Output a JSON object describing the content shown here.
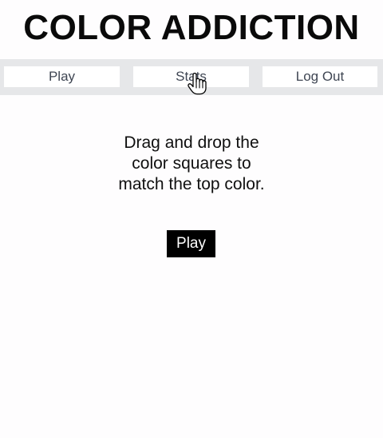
{
  "header": {
    "title": "COLOR ADDICTION"
  },
  "nav": {
    "items": [
      {
        "label": "Play"
      },
      {
        "label": "Stats"
      },
      {
        "label": "Log Out"
      }
    ]
  },
  "main": {
    "instructions_line1": "Drag and drop the",
    "instructions_line2": "color squares to",
    "instructions_line3": "match the top color.",
    "play_label": "Play"
  },
  "cursor": {
    "icon": "hand-pointer-icon"
  },
  "colors": {
    "navbar_background": "#e6e7e9",
    "nav_button_background": "#ffffff",
    "nav_text": "#3f4653",
    "play_button_background": "#000000",
    "play_button_text": "#ffffff"
  }
}
